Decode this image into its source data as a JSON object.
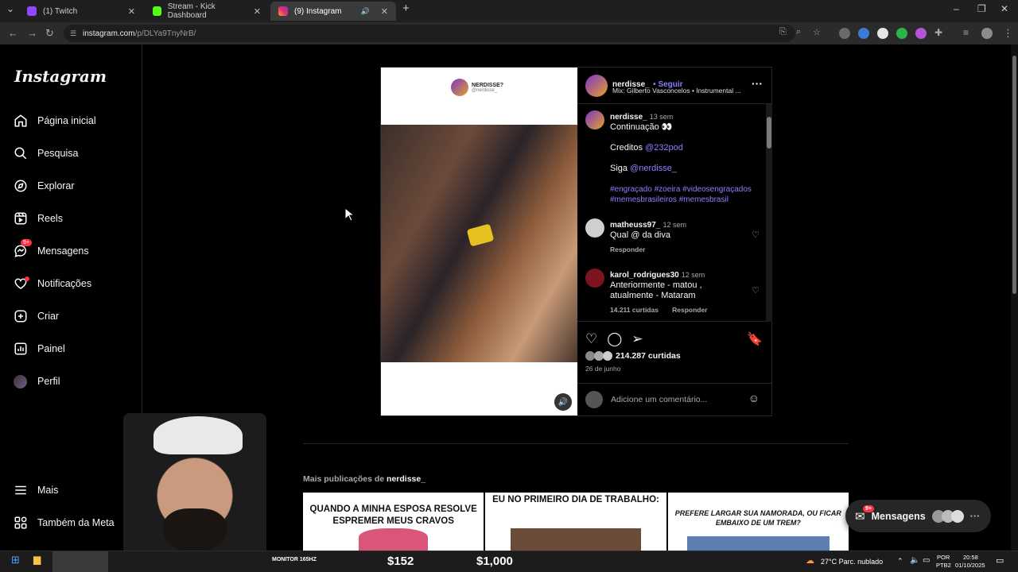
{
  "browser": {
    "tabs": [
      {
        "label": "(1) Twitch",
        "icon": "twitch-icon",
        "color": "#9146ff"
      },
      {
        "label": "Stream - Kick Dashboard",
        "icon": "kick-icon",
        "color": "#53fc18"
      },
      {
        "label": "(9) Instagram",
        "icon": "instagram-icon",
        "color": "#e1306c"
      }
    ],
    "url_host": "instagram.com",
    "url_path": "/p/DLYa9TnyNrB/"
  },
  "sidebar": {
    "logo": "Instagram",
    "items": [
      {
        "label": "Página inicial",
        "icon": "home-icon"
      },
      {
        "label": "Pesquisa",
        "icon": "search-icon"
      },
      {
        "label": "Explorar",
        "icon": "compass-icon"
      },
      {
        "label": "Reels",
        "icon": "reels-icon"
      },
      {
        "label": "Mensagens",
        "icon": "messenger-icon",
        "badge": "9+"
      },
      {
        "label": "Notificações",
        "icon": "heart-icon"
      },
      {
        "label": "Criar",
        "icon": "plus-square-icon"
      },
      {
        "label": "Painel",
        "icon": "dashboard-icon"
      },
      {
        "label": "Perfil",
        "icon": "profile-avatar-icon"
      }
    ],
    "more": "Mais",
    "meta": "Também da Meta"
  },
  "post": {
    "media_top_label": "NERDISSE?",
    "media_top_handle": "@nerdisse_",
    "username": "nerdisse_",
    "follow": "Seguir",
    "music": "Mix: Gilberto Vasconcelos • Instrumental ...",
    "caption": {
      "username": "nerdisse_",
      "time": "13 sem",
      "line1": "Continuação 👀",
      "credits_label": "Creditos",
      "credits_link": "@232pod",
      "follow_label": "Siga",
      "follow_link": "@nerdisse_",
      "hashtags1": "#engraçado #zoeira #videosengraçados",
      "hashtags2": "#memesbrasileiros #memesbrasil"
    },
    "comments": [
      {
        "username": "matheuss97_",
        "time": "12 sem",
        "text": "Qual @ da diva",
        "reply": "Responder"
      },
      {
        "username": "karol_rodrigues30",
        "time": "12 sem",
        "text_line1": "Anteriormente - matou ,",
        "text_line2": "atualmente - Mataram",
        "likes": "14.211 curtidas",
        "reply": "Responder"
      }
    ],
    "likes": "214.287 curtidas",
    "date": "26 de junho",
    "add_comment_placeholder": "Adicione um comentário..."
  },
  "more_posts": {
    "title_prefix": "Mais publicações de",
    "title_user": "nerdisse_",
    "thumbs": [
      {
        "text": "QUANDO A MINHA ESPOSA RESOLVE ESPREMER MEUS CRAVOS"
      },
      {
        "text": "EU NO PRIMEIRO DIA DE TRABALHO:"
      },
      {
        "text": "PREFERE LARGAR SUA NAMORADA, OU FICAR EMBAIXO DE UM TREM?"
      }
    ]
  },
  "floating_dm": {
    "label": "Mensagens",
    "badge": "9+"
  },
  "taskbar": {
    "overlay_left": "MONITOR 165HZ",
    "price1": "$152",
    "price2": "$1,000",
    "weather": "27°C  Parc. nublado",
    "lang": "POR",
    "lang2": "PTB2",
    "time": "20:58",
    "date": "01/10/2025"
  }
}
